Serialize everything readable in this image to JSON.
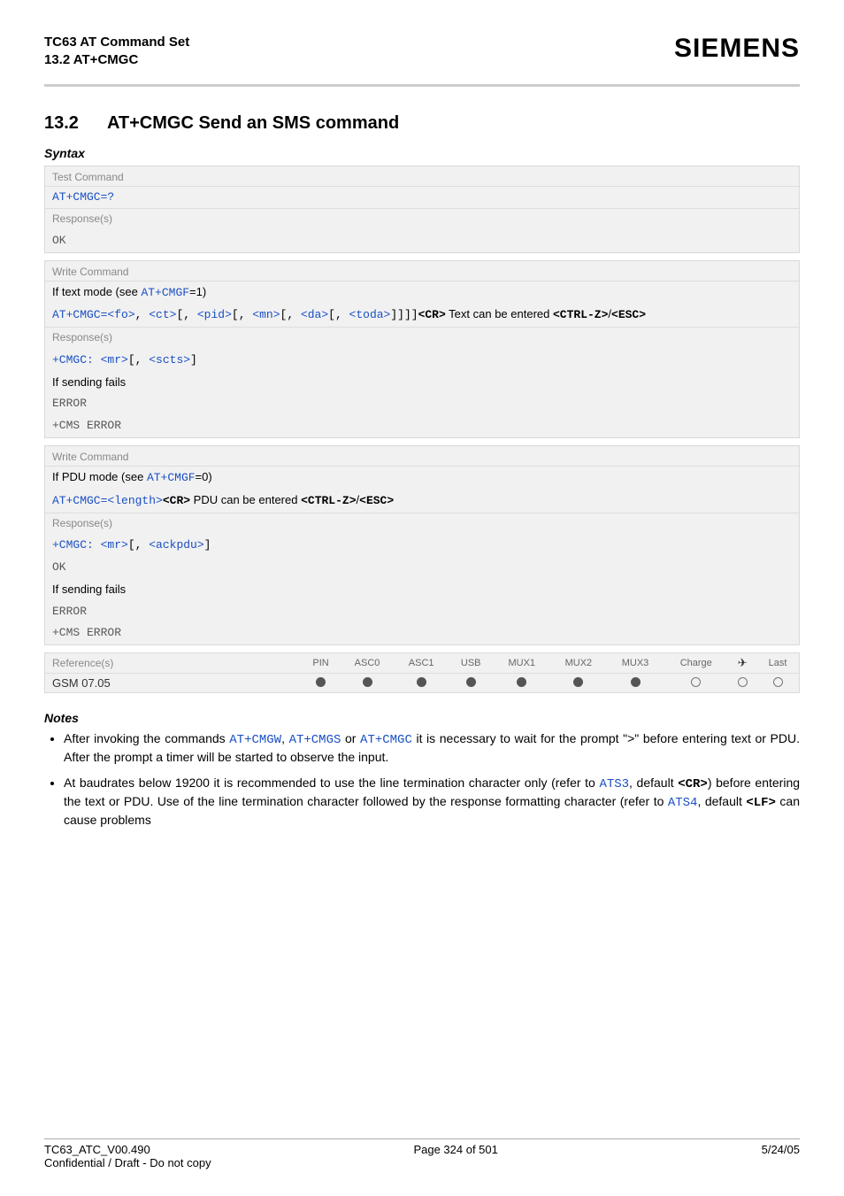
{
  "header": {
    "title_line1": "TC63 AT Command Set",
    "title_line2": "13.2 AT+CMGC",
    "brand": "SIEMENS"
  },
  "section": {
    "number": "13.2",
    "title": "AT+CMGC   Send an SMS command"
  },
  "syntax_label": "Syntax",
  "box1": {
    "label": "Test Command",
    "cmd": "AT+CMGC=?",
    "resp_label": "Response(s)",
    "resp": "OK"
  },
  "box2": {
    "label": "Write Command",
    "mode_prefix": "If text mode (see ",
    "mode_link": "AT+CMGF",
    "mode_suffix": "=1)",
    "cmd_prefix": "AT+CMGC=",
    "fo": "<fo>",
    "ct": "<ct>",
    "pid": "<pid>",
    "mn": "<mn>",
    "da": "<da>",
    "toda": "<toda>",
    "cr": "<CR>",
    "mid": " Text can be entered ",
    "ctrlz": "<CTRL-Z>",
    "esc": "<ESC>",
    "resp_label": "Response(s)",
    "resp_prefix": "+CMGC: ",
    "mr": "<mr>",
    "scts": "<scts>",
    "fail": "If sending fails",
    "error": "ERROR",
    "cms": "+CMS ERROR"
  },
  "box3": {
    "label": "Write Command",
    "mode_prefix": "If PDU mode (see ",
    "mode_link": "AT+CMGF",
    "mode_suffix": "=0)",
    "cmd_prefix": "AT+CMGC=",
    "length": "<length>",
    "cr": "<CR>",
    "mid": " PDU can be entered ",
    "ctrlz": "<CTRL-Z>",
    "esc": "<ESC>",
    "resp_label": "Response(s)",
    "resp_prefix": "+CMGC: ",
    "mr": "<mr>",
    "ackpdu": "<ackpdu>",
    "ok": "OK",
    "fail": "If sending fails",
    "error": "ERROR",
    "cms": "+CMS ERROR"
  },
  "refbox": {
    "ref_label": "Reference(s)",
    "ref_value": "GSM 07.05",
    "cols": [
      "PIN",
      "ASC0",
      "ASC1",
      "USB",
      "MUX1",
      "MUX2",
      "MUX3",
      "Charge",
      "✈",
      "Last"
    ],
    "vals": [
      "f",
      "f",
      "f",
      "f",
      "f",
      "f",
      "f",
      "e",
      "e",
      "e"
    ]
  },
  "notes": {
    "label": "Notes",
    "n1_a": "After invoking the commands ",
    "n1_l1": "AT+CMGW",
    "n1_b": ", ",
    "n1_l2": "AT+CMGS",
    "n1_c": " or ",
    "n1_l3": "AT+CMGC",
    "n1_d": " it is necessary to wait for the prompt \">\" before entering text or PDU. After the prompt a timer will be started to observe the input.",
    "n2_a": "At baudrates below 19200 it is recommended to use the line termination character only (refer to ",
    "n2_l1": "ATS3",
    "n2_b": ", default ",
    "n2_cr": "<CR>",
    "n2_c": ") before entering the text or PDU. Use of the line termination character followed by the response formatting character (refer to ",
    "n2_l2": "ATS4",
    "n2_d": ", default ",
    "n2_lf": "<LF>",
    "n2_e": " can cause problems"
  },
  "footer": {
    "left": "TC63_ATC_V00.490",
    "center": "Page 324 of 501",
    "right": "5/24/05",
    "sub": "Confidential / Draft - Do not copy"
  }
}
